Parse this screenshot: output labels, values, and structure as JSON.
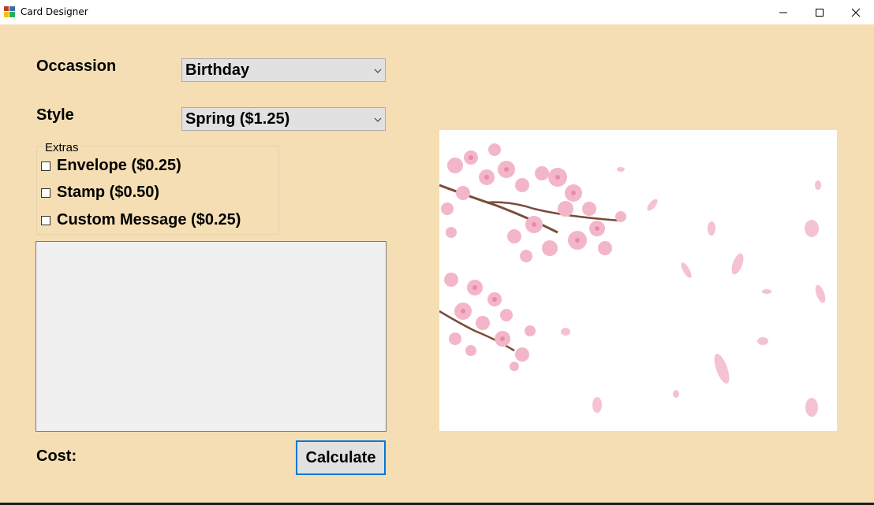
{
  "window": {
    "title": "Card Designer"
  },
  "form": {
    "occasion_label": "Occassion",
    "occasion_value": "Birthday",
    "style_label": "Style",
    "style_value": "Spring ($1.25)",
    "extras_title": "Extras",
    "extras": [
      {
        "label": "Envelope ($0.25)",
        "checked": false
      },
      {
        "label": "Stamp ($0.50)",
        "checked": false
      },
      {
        "label": "Custom Message ($0.25)",
        "checked": false
      }
    ],
    "message_text": "",
    "cost_label": "Cost:",
    "cost_value": "",
    "calculate_label": "Calculate"
  },
  "preview": {
    "image": "cherry-blossom-picture"
  }
}
